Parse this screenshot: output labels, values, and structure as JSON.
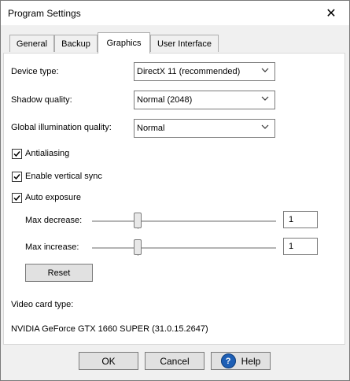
{
  "window": {
    "title": "Program Settings",
    "close_glyph": "✕"
  },
  "tabs": [
    {
      "label": "General"
    },
    {
      "label": "Backup"
    },
    {
      "label": "Graphics"
    },
    {
      "label": "User Interface"
    }
  ],
  "active_tab": "Graphics",
  "graphics": {
    "device_type": {
      "label": "Device type:",
      "value": "DirectX 11 (recommended)"
    },
    "shadow_quality": {
      "label": "Shadow quality:",
      "value": "Normal (2048)"
    },
    "gi_quality": {
      "label": "Global illumination quality:",
      "value": "Normal"
    },
    "antialiasing": {
      "label": "Antialiasing",
      "checked": true
    },
    "vsync": {
      "label": "Enable vertical sync",
      "checked": true
    },
    "auto_exposure": {
      "label": "Auto exposure",
      "checked": true
    },
    "max_decrease": {
      "label": "Max decrease:",
      "value": "1"
    },
    "max_increase": {
      "label": "Max increase:",
      "value": "1"
    },
    "reset_label": "Reset",
    "video_card_label": "Video card type:",
    "video_card_value": "NVIDIA GeForce GTX 1660 SUPER (31.0.15.2647)"
  },
  "footer": {
    "ok_label": "OK",
    "cancel_label": "Cancel",
    "help_label": "Help"
  },
  "icons": {
    "chevron": "chevron-down-icon",
    "check": "checkmark-icon",
    "help": "question-circle-icon"
  },
  "colors": {
    "help_icon": "#1e5fb5",
    "panel_bg": "#ffffff",
    "window_bg": "#f0f0f0"
  }
}
